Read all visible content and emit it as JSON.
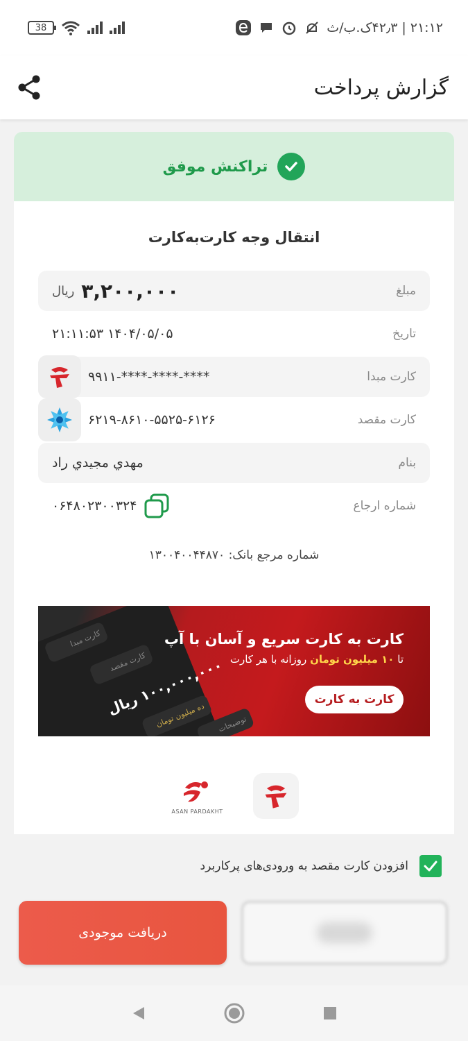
{
  "status_bar": {
    "battery": "38",
    "time_text": "۲۱:۱۲ | ۴۲٫۳ک.ب/ث"
  },
  "app_bar": {
    "title": "گزارش پرداخت",
    "share_icon": "share-icon"
  },
  "transaction": {
    "status": "تراکنش موفق",
    "type": "انتقال وجه کارت‌به‌کارت",
    "rows": {
      "amount_label": "مبلغ",
      "amount_value": "۳,۲۰۰,۰۰۰",
      "amount_unit": "ریال",
      "date_label": "تاریخ",
      "date_value": "۱۴۰۴/۰۵/۰۵ ۲۱:۱۱:۵۳",
      "source_label": "کارت مبدا",
      "source_value": "۹۹۱۱-****-****-****",
      "dest_label": "کارت مقصد",
      "dest_value": "۶۲۱۹-۸۶۱۰-۵۵۲۵-۶۱۲۶",
      "name_label": "بنام",
      "name_value": "مهدي مجيدي راد",
      "ref_label": "شماره ارجاع",
      "ref_value": "۰۶۴۸۰۲۳۰۰۳۲۴"
    },
    "bank_ref": "شماره مرجع بانک: ۱۳۰۰۴۰۰۴۴۸۷۰"
  },
  "promo": {
    "title": "کارت به کارت سریع و آسان با آپ",
    "sub_prefix": "تا",
    "sub_highlight": "۱۰ میلیون تومان",
    "sub_suffix": "روزانه با هر کارت",
    "button": "کارت به کارت",
    "field_source": "کارت مبدا",
    "field_dest": "کارت مقصد",
    "amount": "۱۰۰,۰۰۰,۰۰۰ ریال",
    "field_desc": "توضیحات",
    "field_limit": "ده میلیون تومان"
  },
  "footer": {
    "asan_label": "ASAN PARDAKHT"
  },
  "save_option": {
    "label": "افزودن کارت مقصد به ورودی‌های پرکاربرد",
    "checked": true
  },
  "buttons": {
    "balance": "دریافت موجودی"
  },
  "colors": {
    "success": "#22a559",
    "accent": "#e8553f",
    "promo_red": "#c41a1d"
  }
}
